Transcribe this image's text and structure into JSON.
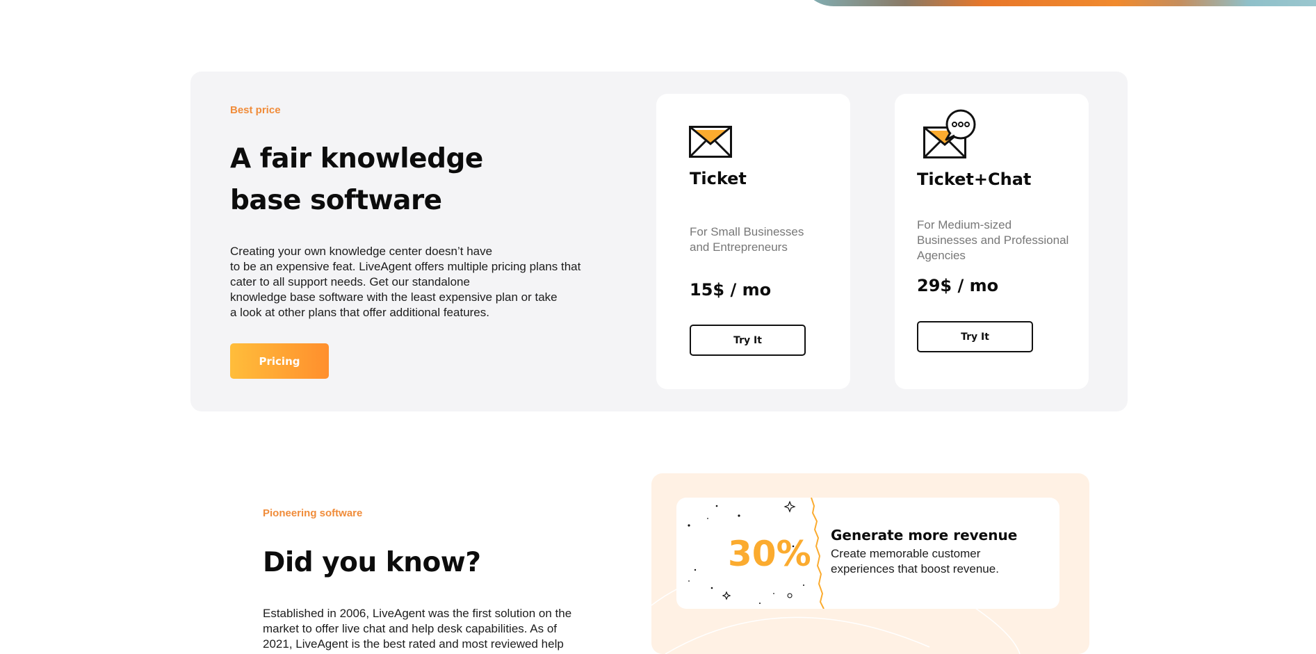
{
  "pricing_section": {
    "eyebrow": "Best price",
    "title_line1": "A fair knowledge",
    "title_line2": "base software",
    "body_lines": [
      "Creating your own knowledge center doesn’t have",
      "to be an expensive feat. LiveAgent offers multiple pricing plans that",
      "cater to all support needs. Get our standalone",
      "knowledge base software with the least expensive plan or take",
      "a look at other plans that offer additional features."
    ],
    "cta_label": "Pricing"
  },
  "plans": [
    {
      "icon": "envelope-icon",
      "name": "Ticket",
      "description_lines": [
        "For Small Businesses",
        "and Entrepreneurs"
      ],
      "price": "15$ / mo",
      "cta_label": "Try It"
    },
    {
      "icon": "envelope-chat-icon",
      "name": "Ticket+Chat",
      "description_lines": [
        "For Medium-sized",
        "Businesses and Professional",
        "Agencies"
      ],
      "price": "29$ / mo",
      "cta_label": "Try It"
    }
  ],
  "about_section": {
    "eyebrow": "Pioneering software",
    "title": "Did you know?",
    "body_lines": [
      "Established in 2006, LiveAgent was the first solution on the",
      "market to offer live chat and help desk capabilities. As of",
      "2021, LiveAgent is the best rated and most reviewed help"
    ]
  },
  "fact_card": {
    "stat": "30%",
    "title": "Generate more revenue",
    "text_lines": [
      "Create memorable customer",
      "experiences that boost revenue."
    ]
  },
  "colors": {
    "accent_orange": "#f08c3a",
    "stat_orange": "#fbab2f",
    "panel_gray": "#f4f4f6",
    "panel_peach": "#fff1e4"
  }
}
